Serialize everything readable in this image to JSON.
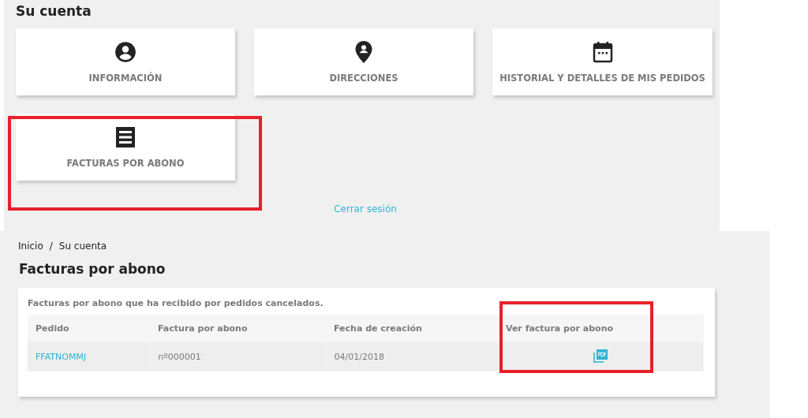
{
  "account": {
    "title": "Su cuenta",
    "tiles": [
      {
        "kind": "user",
        "label": "INFORMACIÓN"
      },
      {
        "kind": "pin",
        "label": "DIRECCIONES"
      },
      {
        "kind": "calendar",
        "label": "HISTORIAL Y DETALLES DE MIS PEDIDOS"
      },
      {
        "kind": "receipt",
        "label": "FACTURAS POR ABONO"
      }
    ],
    "logout_link": "Cerrar sesión"
  },
  "credit_slips": {
    "breadcrumb": [
      {
        "label": "Inicio"
      },
      {
        "label": "Su cuenta"
      }
    ],
    "separator": "/",
    "title": "Facturas por abono",
    "description": "Facturas por abono que ha recibido por pedidos cancelados.",
    "table": {
      "columns": [
        "Pedido",
        "Factura por abono",
        "Fecha de creación",
        "Ver factura por abono"
      ],
      "rows": [
        {
          "order": "FFATNOMMJ",
          "slip": "nº000001",
          "date": "04/01/2018"
        }
      ]
    }
  }
}
